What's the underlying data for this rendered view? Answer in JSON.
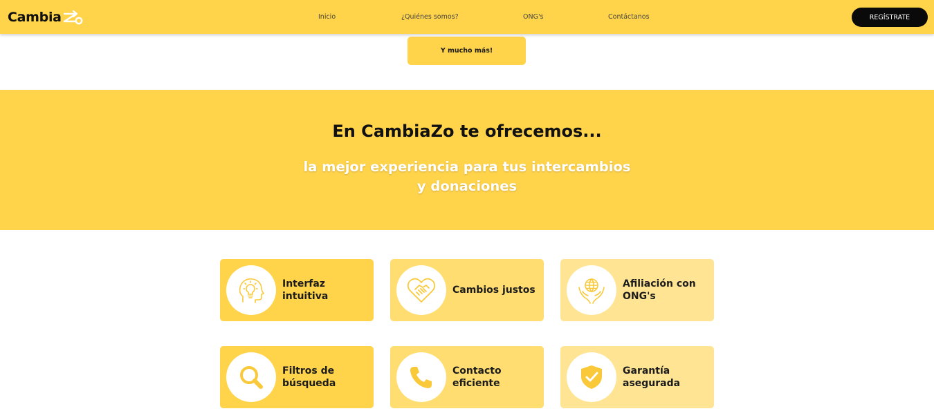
{
  "header": {
    "logo_text": "Cambia",
    "nav": [
      "Inicio",
      "¿Quiénes somos?",
      "ONG's",
      "Contáctanos"
    ],
    "register_label": "REGÍSTRATE"
  },
  "more_button_label": "Y mucho más!",
  "offer": {
    "title": "En CambiaZo te ofrecemos...",
    "subtitle_line1": "la mejor experiencia para tus intercambios",
    "subtitle_line2": "y donaciones"
  },
  "features": [
    {
      "line1": "Interfaz",
      "line2": "intuitiva",
      "icon": "lightbulb-head-icon"
    },
    {
      "line1": "Cambios justos",
      "line2": "",
      "icon": "handshake-heart-icon"
    },
    {
      "line1": "Afiliación con",
      "line2": "ONG's",
      "icon": "globe-hands-icon"
    },
    {
      "line1": "Filtros de",
      "line2": "búsqueda",
      "icon": "magnifier-icon"
    },
    {
      "line1": "Contacto",
      "line2": "eficiente",
      "icon": "phone-icon"
    },
    {
      "line1": "Garantía",
      "line2": "asegurada",
      "icon": "shield-check-icon"
    }
  ],
  "colors": {
    "brand_yellow": "#ffd34a",
    "card_mid": "#ffdd70",
    "card_light": "#ffe494",
    "button_dark": "#0a0a0a",
    "icon_yellow": "#f9c93a"
  }
}
